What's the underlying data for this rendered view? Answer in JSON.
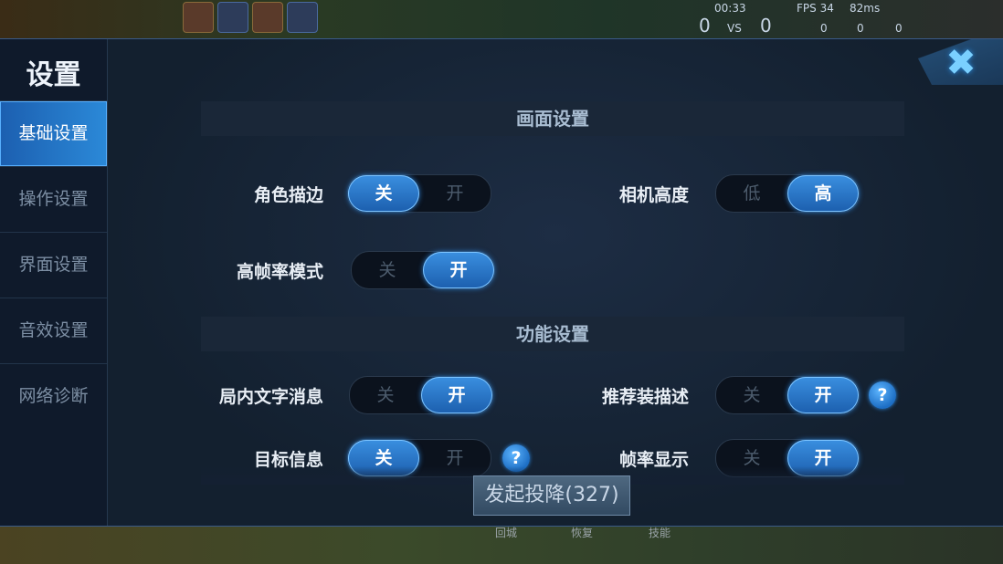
{
  "hud": {
    "timer": "00:33",
    "score_blue": "0",
    "vs": "VS",
    "score_red": "0",
    "fps": "FPS 34",
    "ping": "82ms",
    "kills": "0",
    "deaths": "0",
    "assists": "0"
  },
  "bottom_labels": [
    "回城",
    "恢复",
    "技能"
  ],
  "sidebar": {
    "title": "设置",
    "items": [
      {
        "label": "基础设置",
        "active": true
      },
      {
        "label": "操作设置",
        "active": false
      },
      {
        "label": "界面设置",
        "active": false
      },
      {
        "label": "音效设置",
        "active": false
      },
      {
        "label": "网络诊断",
        "active": false
      }
    ]
  },
  "sections": {
    "display": "画面设置",
    "function": "功能设置"
  },
  "settings": {
    "outline": {
      "label": "角色描边",
      "off": "关",
      "on": "开",
      "value": "off"
    },
    "camera": {
      "label": "相机高度",
      "off": "低",
      "on": "高",
      "value": "on"
    },
    "hfr": {
      "label": "高帧率模式",
      "off": "关",
      "on": "开",
      "value": "on"
    },
    "chat": {
      "label": "局内文字消息",
      "off": "关",
      "on": "开",
      "value": "on"
    },
    "equip_desc": {
      "label": "推荐装描述",
      "off": "关",
      "on": "开",
      "value": "on"
    },
    "target_info": {
      "label": "目标信息",
      "off": "关",
      "on": "开",
      "value": "off"
    },
    "fps_display": {
      "label": "帧率显示",
      "off": "关",
      "on": "开",
      "value": "on"
    }
  },
  "help_symbol": "?",
  "close_symbol": "✖",
  "surrender": "发起投降(327)"
}
